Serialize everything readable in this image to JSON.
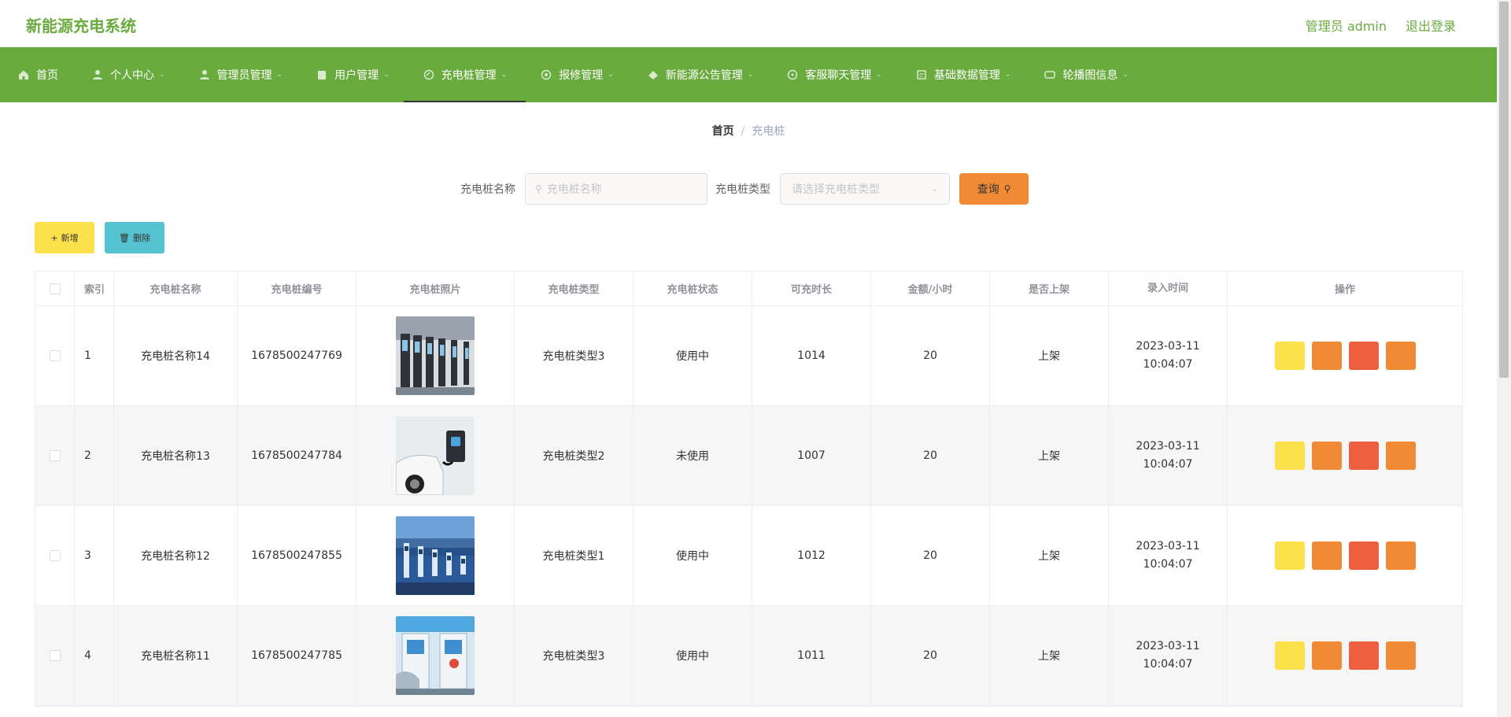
{
  "header": {
    "brand": "新能源充电系统",
    "user_label": "管理员 admin",
    "logout": "退出登录"
  },
  "nav": [
    {
      "label": "首页",
      "icon": "home-icon",
      "chev": false,
      "active": false
    },
    {
      "label": "个人中心",
      "icon": "user-icon",
      "chev": true,
      "active": false
    },
    {
      "label": "管理员管理",
      "icon": "admin-icon",
      "chev": true,
      "active": false
    },
    {
      "label": "用户管理",
      "icon": "users-icon",
      "chev": true,
      "active": false
    },
    {
      "label": "充电桩管理",
      "icon": "charger-icon",
      "chev": true,
      "active": true
    },
    {
      "label": "报修管理",
      "icon": "repair-icon",
      "chev": true,
      "active": false
    },
    {
      "label": "新能源公告管理",
      "icon": "notice-icon",
      "chev": true,
      "active": false
    },
    {
      "label": "客服聊天管理",
      "icon": "chat-icon",
      "chev": true,
      "active": false
    },
    {
      "label": "基础数据管理",
      "icon": "data-icon",
      "chev": true,
      "active": false
    },
    {
      "label": "轮播图信息",
      "icon": "carousel-icon",
      "chev": true,
      "active": false
    }
  ],
  "breadcrumb": {
    "home": "首页",
    "sep": "/",
    "current": "充电桩"
  },
  "search": {
    "name_label": "充电桩名称",
    "name_placeholder": "充电桩名称",
    "type_label": "充电桩类型",
    "type_placeholder": "请选择充电桩类型",
    "query_label": "查询"
  },
  "actions": {
    "add": "新增",
    "delete": "删除"
  },
  "table": {
    "headers": [
      "",
      "索引",
      "充电桩名称",
      "充电桩编号",
      "充电桩照片",
      "充电桩类型",
      "充电桩状态",
      "可充时长",
      "金额/小时",
      "是否上架",
      "录入时间",
      "操作"
    ],
    "rows": [
      {
        "index": "1",
        "name": "充电桩名称14",
        "code": "1678500247769",
        "type": "充电桩类型3",
        "status": "使用中",
        "duration": "1014",
        "price": "20",
        "shelf": "上架",
        "time": "2023-03-11 10:04:07",
        "photo": "charger-row-photo"
      },
      {
        "index": "2",
        "name": "充电桩名称13",
        "code": "1678500247784",
        "type": "充电桩类型2",
        "status": "未使用",
        "duration": "1007",
        "price": "20",
        "shelf": "上架",
        "time": "2023-03-11 10:04:07",
        "photo": "car-charging-photo"
      },
      {
        "index": "3",
        "name": "充电桩名称12",
        "code": "1678500247855",
        "type": "充电桩类型1",
        "status": "使用中",
        "duration": "1012",
        "price": "20",
        "shelf": "上架",
        "time": "2023-03-11 10:04:07",
        "photo": "blue-chargers-photo"
      },
      {
        "index": "4",
        "name": "充电桩名称11",
        "code": "1678500247785",
        "type": "充电桩类型3",
        "status": "使用中",
        "duration": "1011",
        "price": "20",
        "shelf": "上架",
        "time": "2023-03-11 10:04:07",
        "photo": "ev-charging-photo"
      }
    ]
  },
  "colors": {
    "brand_green": "#6aab3f",
    "query_orange": "#f08a35",
    "add_yellow": "#fbe14c",
    "delete_cyan": "#55c2cf",
    "op_red": "#ec5f3f"
  }
}
